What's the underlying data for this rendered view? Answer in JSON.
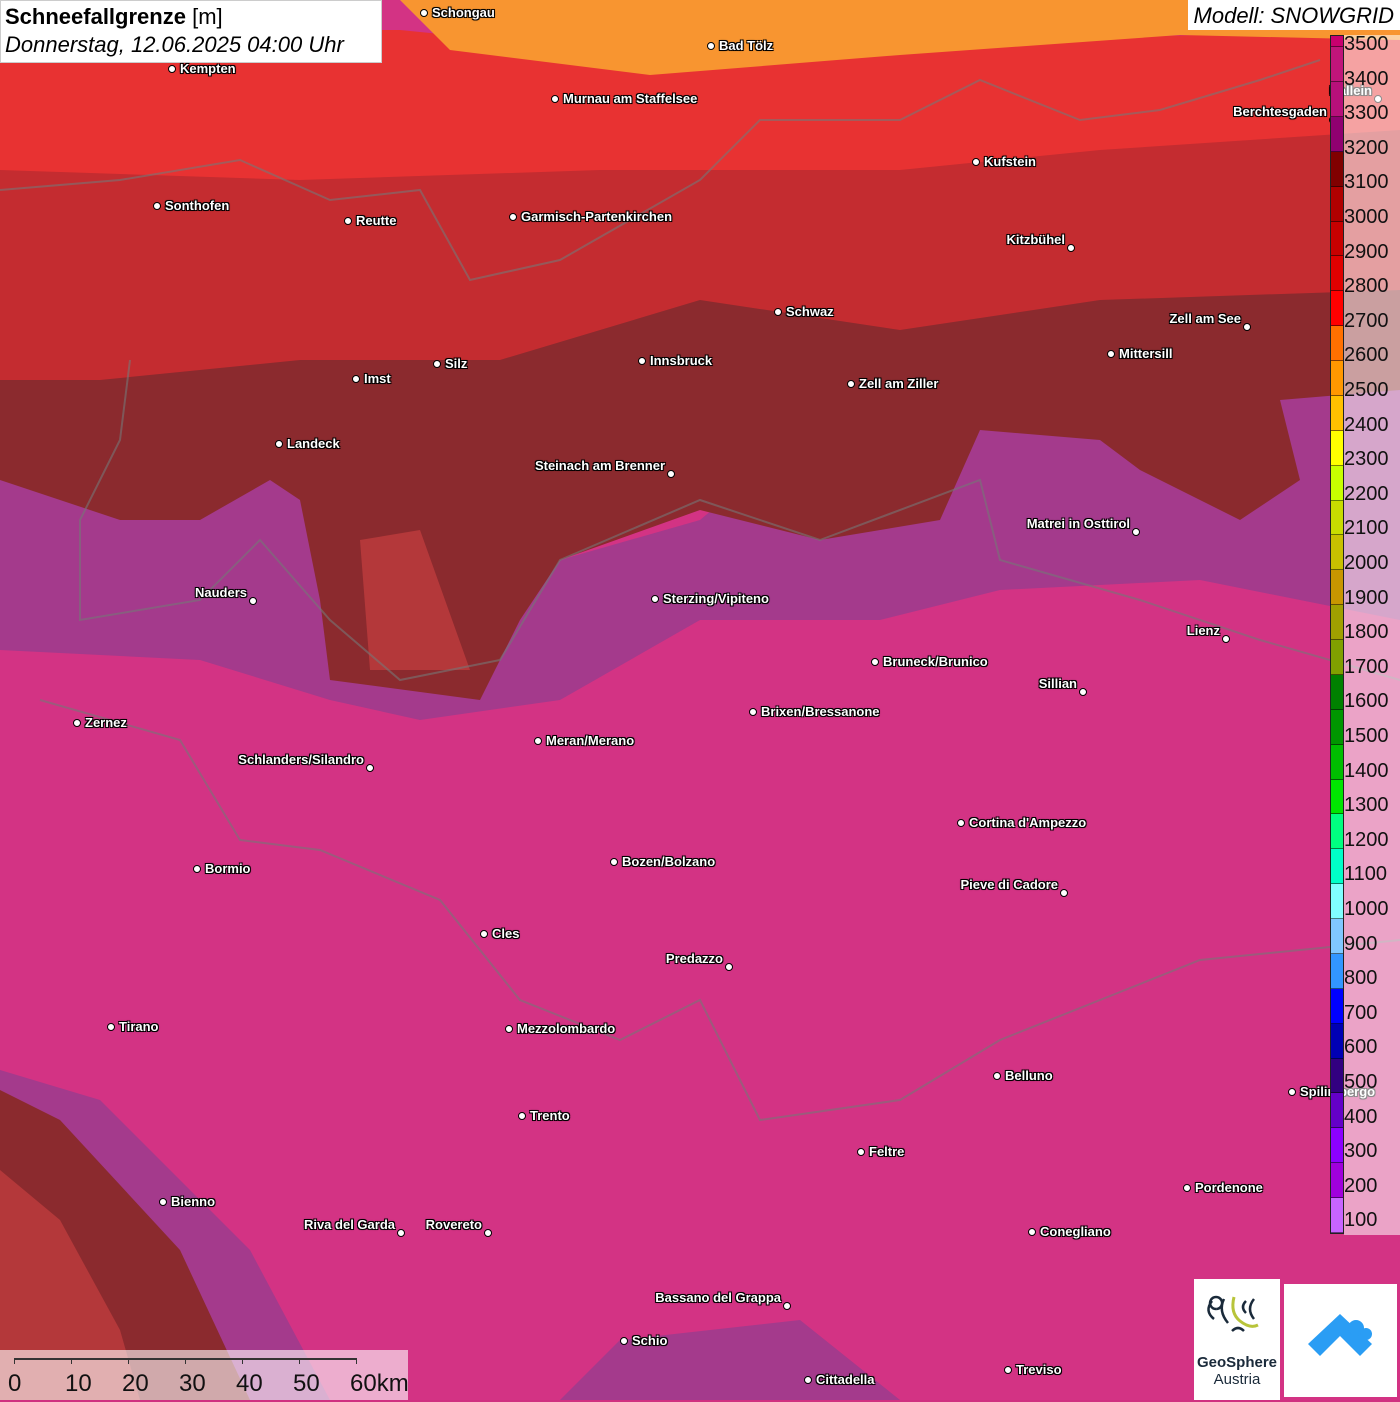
{
  "title": {
    "name": "Schneefallgrenze",
    "unit": "[m]",
    "datetime": "Donnerstag, 12.06.2025 04:00 Uhr"
  },
  "model": "Modell: SNOWGRID",
  "legend": {
    "labels": [
      "3500",
      "3400",
      "3300",
      "3200",
      "3100",
      "3000",
      "2900",
      "2800",
      "2700",
      "2600",
      "2500",
      "2400",
      "2300",
      "2200",
      "2100",
      "2000",
      "1900",
      "1800",
      "1700",
      "1600",
      "1500",
      "1400",
      "1300",
      "1200",
      "1100",
      "1000",
      "900",
      "800",
      "700",
      "600",
      "500",
      "400",
      "300",
      "200",
      "100"
    ],
    "colors": [
      "#c8006e",
      "#c0157a",
      "#b8107a",
      "#900070",
      "#800000",
      "#b00000",
      "#c80000",
      "#e00000",
      "#ff0000",
      "#ff7000",
      "#ff9800",
      "#ffc000",
      "#ffff00",
      "#c8ff00",
      "#c8dc00",
      "#c8c000",
      "#c89600",
      "#a0a000",
      "#80a000",
      "#008000",
      "#009600",
      "#00be00",
      "#00e600",
      "#00ff80",
      "#00ffc8",
      "#80ffff",
      "#80c8ff",
      "#3296ff",
      "#0000ff",
      "#0000b4",
      "#320080",
      "#6400c8",
      "#8c00ff",
      "#a000dc",
      "#c864ff"
    ]
  },
  "cities": [
    "Schongau",
    "Kempten",
    "Bad Tölz",
    "Murnau am Staffelsee",
    "Kufstein",
    "Berchtesgaden",
    "Sonthofen",
    "Reutte",
    "Garmisch-Partenkirchen",
    "Kitzbühel",
    "Schwaz",
    "Zell am See",
    "Mittersill",
    "Imst",
    "Silz",
    "Innsbruck",
    "Zell am Ziller",
    "Landeck",
    "Steinach am Brenner",
    "Matrei in Osttirol",
    "Nauders",
    "Sterzing/Vipiteno",
    "Lienz",
    "Bruneck/Brunico",
    "Sillian",
    "Zernez",
    "Brixen/Bressanone",
    "Meran/Merano",
    "Schlanders/Silandro",
    "Cortina d'Ampezzo",
    "Bormio",
    "Bozen/Bolzano",
    "Pieve di Cadore",
    "Cles",
    "Predazzo",
    "Tirano",
    "Mezzolombardo",
    "Belluno",
    "Spilimbergo",
    "Trento",
    "Feltre",
    "Pordenone",
    "Bienno",
    "Riva del Garda",
    "Rovereto",
    "Conegliano",
    "Bassano del Grappa",
    "Schio",
    "Treviso",
    "Cittadella",
    "Hallein"
  ],
  "scale": {
    "labels": [
      "0",
      "10",
      "20",
      "30",
      "40",
      "50",
      "60km"
    ]
  },
  "logos": {
    "geosphere_line1": "GeoSphere",
    "geosphere_line2": "Austria"
  }
}
